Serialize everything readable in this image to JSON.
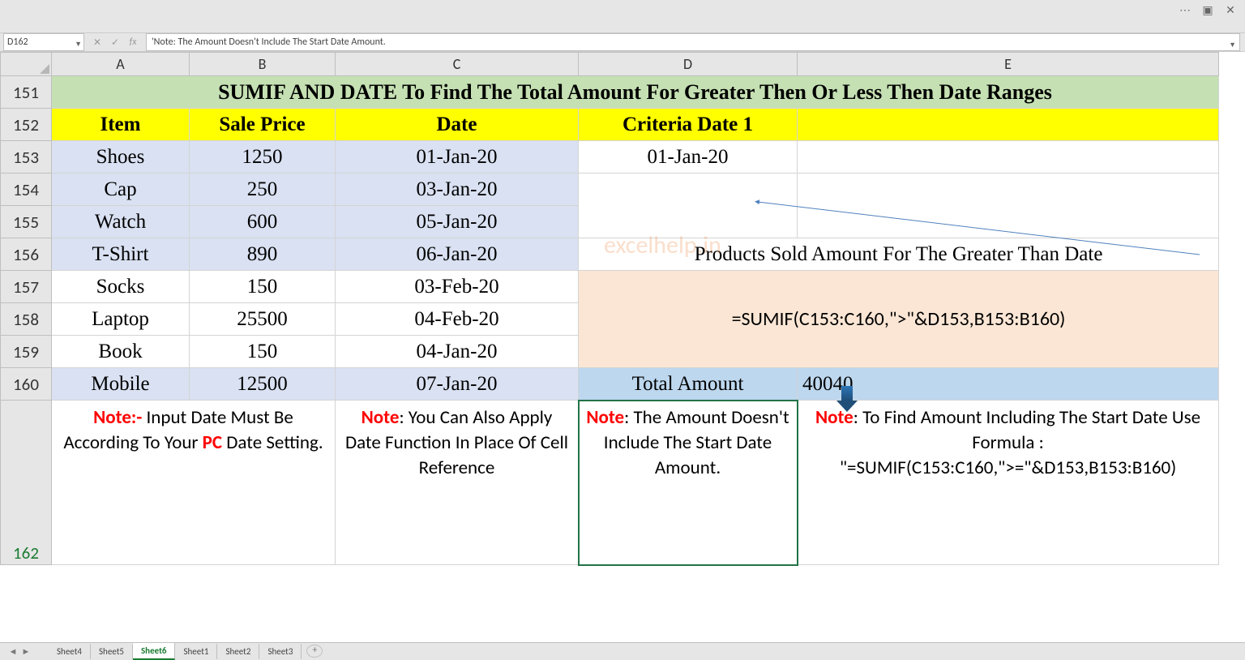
{
  "titlebar": {},
  "namebox": "D162",
  "formula_bar": "'Note: The Amount Doesn't Include The Start Date Amount.",
  "columns": [
    "A",
    "B",
    "C",
    "D",
    "E"
  ],
  "row_nums": [
    151,
    152,
    153,
    154,
    155,
    156,
    157,
    158,
    159,
    160,
    162
  ],
  "title_merged": "SUMIF AND DATE To Find The Total Amount For Greater Then Or Less Then Date Ranges",
  "headers": {
    "item": "Item",
    "price": "Sale Price",
    "date": "Date",
    "crit": "Criteria Date 1"
  },
  "rows": [
    {
      "item": "Shoes",
      "price": "1250",
      "date": "01-Jan-20",
      "d": "01-Jan-20"
    },
    {
      "item": "Cap",
      "price": "250",
      "date": "03-Jan-20"
    },
    {
      "item": "Watch",
      "price": "600",
      "date": "05-Jan-20"
    },
    {
      "item": "T-Shirt",
      "price": "890",
      "date": "06-Jan-20",
      "d": "Products Sold Amount For The Greater Than Date",
      "merge_d": true
    },
    {
      "item": "Socks",
      "price": "150",
      "date": "03-Feb-20"
    },
    {
      "item": "Laptop",
      "price": "25500",
      "date": "04-Feb-20",
      "d": "=SUMIF(C153:C160,\">\"&D153,B153:B160)",
      "merge_d": true,
      "peach": true
    },
    {
      "item": "Book",
      "price": "150",
      "date": "04-Jan-20"
    },
    {
      "item": "Mobile",
      "price": "12500",
      "date": "07-Jan-20",
      "d": "Total Amount",
      "e": "40040"
    }
  ],
  "notes": {
    "a": {
      "pre": "Note:-",
      "mid": " Input Date Must Be According To Your ",
      "pc": "PC",
      "tail": " Date Setting."
    },
    "c": {
      "pre": "Note",
      "body": ": You Can Also Apply Date Function In Place Of Cell Reference"
    },
    "d": {
      "pre": "Note",
      "body": ": The Amount Doesn't Include The Start Date Amount."
    },
    "e": {
      "pre": "Note",
      "body": ": To Find Amount Including The Start Date Use Formula : \"=SUMIF(C153:C160,\">=\"&D153,B153:B160)"
    }
  },
  "tabs": [
    "Sheet4",
    "Sheet5",
    "Sheet6",
    "Sheet1",
    "Sheet2",
    "Sheet3"
  ],
  "active_tab": "Sheet6",
  "watermark": "excelhelp.in",
  "chart_data": {
    "type": "table",
    "columns": [
      "Item",
      "Sale Price",
      "Date"
    ],
    "rows": [
      [
        "Shoes",
        1250,
        "01-Jan-20"
      ],
      [
        "Cap",
        250,
        "03-Jan-20"
      ],
      [
        "Watch",
        600,
        "05-Jan-20"
      ],
      [
        "T-Shirt",
        890,
        "06-Jan-20"
      ],
      [
        "Socks",
        150,
        "03-Feb-20"
      ],
      [
        "Laptop",
        25500,
        "04-Feb-20"
      ],
      [
        "Book",
        150,
        "04-Jan-20"
      ],
      [
        "Mobile",
        12500,
        "07-Jan-20"
      ]
    ],
    "criteria_date": "01-Jan-20",
    "formula": "=SUMIF(C153:C160,\">\"&D153,B153:B160)",
    "total_amount": 40040
  }
}
